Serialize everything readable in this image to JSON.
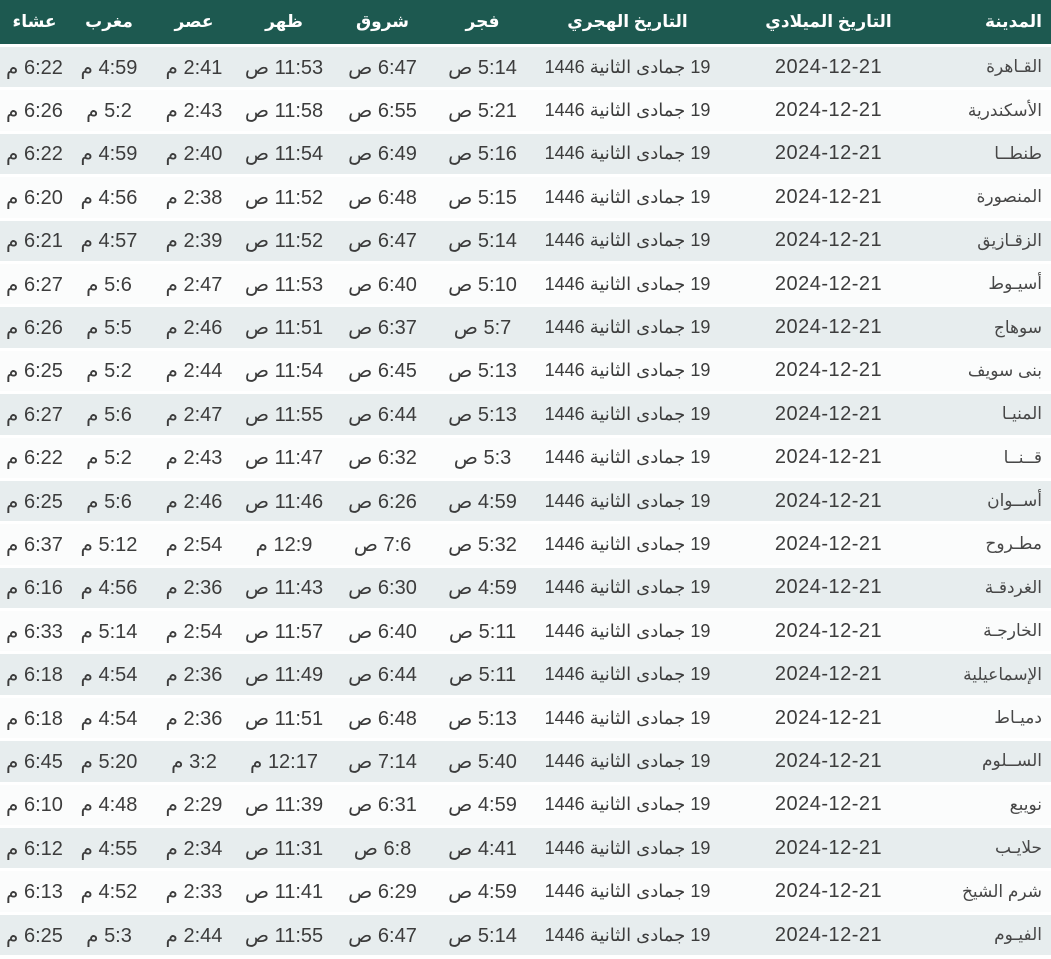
{
  "colors": {
    "header_bg": "#1d5950",
    "header_text": "#ffffff",
    "row_odd_bg": "#e7edee",
    "row_even_bg": "#fbfcfc",
    "row_separator": "#ffffff",
    "cell_text": "#3c3c3c"
  },
  "table": {
    "columns": [
      {
        "key": "city",
        "label": "المدينة"
      },
      {
        "key": "gregorian",
        "label": "التاريخ الميلادي"
      },
      {
        "key": "hijri",
        "label": "التاريخ الهجري"
      },
      {
        "key": "fajr",
        "label": "فجر"
      },
      {
        "key": "sunrise",
        "label": "شروق"
      },
      {
        "key": "dhuhr",
        "label": "ظهر"
      },
      {
        "key": "asr",
        "label": "عصر"
      },
      {
        "key": "maghrib",
        "label": "مغرب"
      },
      {
        "key": "isha",
        "label": "عشاء"
      }
    ],
    "rows": [
      {
        "city": "القـاهرة",
        "gregorian": "2024-12-21",
        "hijri": "19 جمادى الثانية 1446",
        "fajr": "5:14 ص",
        "sunrise": "6:47 ص",
        "dhuhr": "11:53 ص",
        "asr": "2:41 م",
        "maghrib": "4:59 م",
        "isha": "6:22 م"
      },
      {
        "city": "الأسكندرية",
        "gregorian": "2024-12-21",
        "hijri": "19 جمادى الثانية 1446",
        "fajr": "5:21 ص",
        "sunrise": "6:55 ص",
        "dhuhr": "11:58 ص",
        "asr": "2:43 م",
        "maghrib": "5:2 م",
        "isha": "6:26 م"
      },
      {
        "city": "طنطــا",
        "gregorian": "2024-12-21",
        "hijri": "19 جمادى الثانية 1446",
        "fajr": "5:16 ص",
        "sunrise": "6:49 ص",
        "dhuhr": "11:54 ص",
        "asr": "2:40 م",
        "maghrib": "4:59 م",
        "isha": "6:22 م"
      },
      {
        "city": "المنصورة",
        "gregorian": "2024-12-21",
        "hijri": "19 جمادى الثانية 1446",
        "fajr": "5:15 ص",
        "sunrise": "6:48 ص",
        "dhuhr": "11:52 ص",
        "asr": "2:38 م",
        "maghrib": "4:56 م",
        "isha": "6:20 م"
      },
      {
        "city": "الزقـازيق",
        "gregorian": "2024-12-21",
        "hijri": "19 جمادى الثانية 1446",
        "fajr": "5:14 ص",
        "sunrise": "6:47 ص",
        "dhuhr": "11:52 ص",
        "asr": "2:39 م",
        "maghrib": "4:57 م",
        "isha": "6:21 م"
      },
      {
        "city": "أسيـوط",
        "gregorian": "2024-12-21",
        "hijri": "19 جمادى الثانية 1446",
        "fajr": "5:10 ص",
        "sunrise": "6:40 ص",
        "dhuhr": "11:53 ص",
        "asr": "2:47 م",
        "maghrib": "5:6 م",
        "isha": "6:27 م"
      },
      {
        "city": "سوهاج",
        "gregorian": "2024-12-21",
        "hijri": "19 جمادى الثانية 1446",
        "fajr": "5:7 ص",
        "sunrise": "6:37 ص",
        "dhuhr": "11:51 ص",
        "asr": "2:46 م",
        "maghrib": "5:5 م",
        "isha": "6:26 م"
      },
      {
        "city": "بنى سويف",
        "gregorian": "2024-12-21",
        "hijri": "19 جمادى الثانية 1446",
        "fajr": "5:13 ص",
        "sunrise": "6:45 ص",
        "dhuhr": "11:54 ص",
        "asr": "2:44 م",
        "maghrib": "5:2 م",
        "isha": "6:25 م"
      },
      {
        "city": "المنيـا",
        "gregorian": "2024-12-21",
        "hijri": "19 جمادى الثانية 1446",
        "fajr": "5:13 ص",
        "sunrise": "6:44 ص",
        "dhuhr": "11:55 ص",
        "asr": "2:47 م",
        "maghrib": "5:6 م",
        "isha": "6:27 م"
      },
      {
        "city": "قــنــا",
        "gregorian": "2024-12-21",
        "hijri": "19 جمادى الثانية 1446",
        "fajr": "5:3 ص",
        "sunrise": "6:32 ص",
        "dhuhr": "11:47 ص",
        "asr": "2:43 م",
        "maghrib": "5:2 م",
        "isha": "6:22 م"
      },
      {
        "city": "أســوان",
        "gregorian": "2024-12-21",
        "hijri": "19 جمادى الثانية 1446",
        "fajr": "4:59 ص",
        "sunrise": "6:26 ص",
        "dhuhr": "11:46 ص",
        "asr": "2:46 م",
        "maghrib": "5:6 م",
        "isha": "6:25 م"
      },
      {
        "city": "مطـروح",
        "gregorian": "2024-12-21",
        "hijri": "19 جمادى الثانية 1446",
        "fajr": "5:32 ص",
        "sunrise": "7:6 ص",
        "dhuhr": "12:9 م",
        "asr": "2:54 م",
        "maghrib": "5:12 م",
        "isha": "6:37 م"
      },
      {
        "city": "الغردقـة",
        "gregorian": "2024-12-21",
        "hijri": "19 جمادى الثانية 1446",
        "fajr": "4:59 ص",
        "sunrise": "6:30 ص",
        "dhuhr": "11:43 ص",
        "asr": "2:36 م",
        "maghrib": "4:56 م",
        "isha": "6:16 م"
      },
      {
        "city": "الخارجـة",
        "gregorian": "2024-12-21",
        "hijri": "19 جمادى الثانية 1446",
        "fajr": "5:11 ص",
        "sunrise": "6:40 ص",
        "dhuhr": "11:57 ص",
        "asr": "2:54 م",
        "maghrib": "5:14 م",
        "isha": "6:33 م"
      },
      {
        "city": "الإسماعيلية",
        "gregorian": "2024-12-21",
        "hijri": "19 جمادى الثانية 1446",
        "fajr": "5:11 ص",
        "sunrise": "6:44 ص",
        "dhuhr": "11:49 ص",
        "asr": "2:36 م",
        "maghrib": "4:54 م",
        "isha": "6:18 م"
      },
      {
        "city": "دميـاط",
        "gregorian": "2024-12-21",
        "hijri": "19 جمادى الثانية 1446",
        "fajr": "5:13 ص",
        "sunrise": "6:48 ص",
        "dhuhr": "11:51 ص",
        "asr": "2:36 م",
        "maghrib": "4:54 م",
        "isha": "6:18 م"
      },
      {
        "city": "الســلوم",
        "gregorian": "2024-12-21",
        "hijri": "19 جمادى الثانية 1446",
        "fajr": "5:40 ص",
        "sunrise": "7:14 ص",
        "dhuhr": "12:17 م",
        "asr": "3:2 م",
        "maghrib": "5:20 م",
        "isha": "6:45 م"
      },
      {
        "city": "نويبع",
        "gregorian": "2024-12-21",
        "hijri": "19 جمادى الثانية 1446",
        "fajr": "4:59 ص",
        "sunrise": "6:31 ص",
        "dhuhr": "11:39 ص",
        "asr": "2:29 م",
        "maghrib": "4:48 م",
        "isha": "6:10 م"
      },
      {
        "city": "حلايـب",
        "gregorian": "2024-12-21",
        "hijri": "19 جمادى الثانية 1446",
        "fajr": "4:41 ص",
        "sunrise": "6:8 ص",
        "dhuhr": "11:31 ص",
        "asr": "2:34 م",
        "maghrib": "4:55 م",
        "isha": "6:12 م"
      },
      {
        "city": "شرم الشيخ",
        "gregorian": "2024-12-21",
        "hijri": "19 جمادى الثانية 1446",
        "fajr": "4:59 ص",
        "sunrise": "6:29 ص",
        "dhuhr": "11:41 ص",
        "asr": "2:33 م",
        "maghrib": "4:52 م",
        "isha": "6:13 م"
      },
      {
        "city": "الفيـوم",
        "gregorian": "2024-12-21",
        "hijri": "19 جمادى الثانية 1446",
        "fajr": "5:14 ص",
        "sunrise": "6:47 ص",
        "dhuhr": "11:55 ص",
        "asr": "2:44 م",
        "maghrib": "5:3 م",
        "isha": "6:25 م"
      }
    ]
  }
}
